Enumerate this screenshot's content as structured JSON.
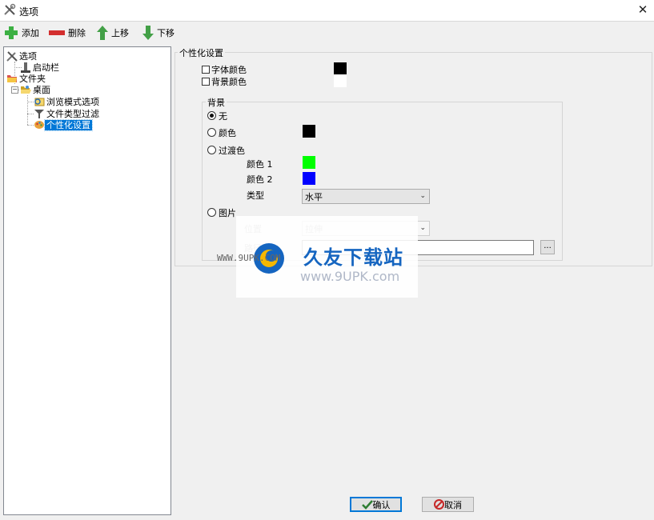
{
  "window": {
    "title": "选项",
    "close_label": "✕"
  },
  "toolbar": {
    "add_label": "添加",
    "delete_label": "删除",
    "up_label": "上移",
    "down_label": "下移"
  },
  "tree": {
    "root": "选项",
    "items": [
      "启动栏",
      "文件夹",
      "桌面",
      "浏览模式选项",
      "文件类型过滤",
      "个性化设置"
    ],
    "selected": "个性化设置"
  },
  "personalization": {
    "group_title": "个性化设置",
    "font_color_label": "字体颜色",
    "bg_color_label": "背景颜色",
    "font_color": "#000000",
    "bg_color": "#ffffff",
    "background": {
      "group_title": "背景",
      "none_label": "无",
      "color_label": "颜色",
      "color": "#000000",
      "gradient_label": "过渡色",
      "color1_label": "颜色 1",
      "color1": "#00ff00",
      "color2_label": "颜色 2",
      "color2": "#0000ff",
      "type_label": "类型",
      "type_value": "水平",
      "image_label": "图片",
      "position_label": "位置",
      "position_value": "拉伸",
      "path_label": "路径",
      "path_value": "",
      "browse_label": "...",
      "selected_option": "无"
    }
  },
  "buttons": {
    "ok_label": "确认",
    "cancel_label": "取消"
  },
  "watermark": {
    "title": "久友下载站",
    "url": "www.9UPK.com",
    "side_text": "WWW.9UPK.COM"
  },
  "colors": {
    "selection": "#0078d7",
    "add_icon": "#3cb043",
    "delete_icon": "#d32f2f",
    "move_icon": "#43a047"
  }
}
